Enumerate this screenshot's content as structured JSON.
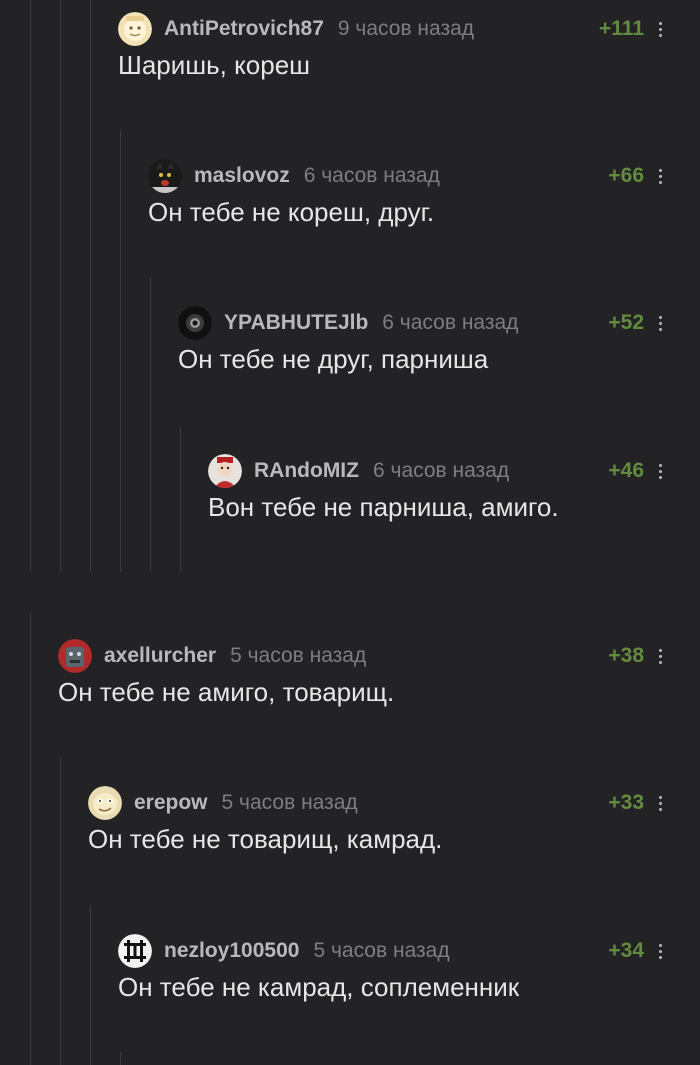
{
  "comments": [
    {
      "username": "AntiPetrovich87",
      "time": "9 часов назад",
      "rating": "+111",
      "text": "Шаришь, кореш",
      "avatar": "light-face-avatar"
    },
    {
      "username": "maslovoz",
      "time": "6 часов назад",
      "rating": "+66",
      "text": "Он тебе не кореш, друг.",
      "avatar": "black-cat-avatar"
    },
    {
      "username": "YPABHUTEJlb",
      "time": "6 часов назад",
      "rating": "+52",
      "text": "Он тебе не друг, парниша",
      "avatar": "dark-eye-avatar"
    },
    {
      "username": "RAndoMIZ",
      "time": "6 часов назад",
      "rating": "+46",
      "text": "Вон тебе не парниша, амиго.",
      "avatar": "red-character-avatar"
    },
    {
      "username": "axellurcher",
      "time": "5 часов назад",
      "rating": "+38",
      "text": "Он тебе не амиго, товарищ.",
      "avatar": "gray-character-avatar"
    },
    {
      "username": "erepow",
      "time": "5 часов назад",
      "rating": "+33",
      "text": "Он тебе не товарищ, камрад.",
      "avatar": "cartoon-face-avatar"
    },
    {
      "username": "nezloy100500",
      "time": "5 часов назад",
      "rating": "+34",
      "text": "Он тебе не камрад, соплеменник",
      "avatar": "band-logo-avatar"
    }
  ]
}
